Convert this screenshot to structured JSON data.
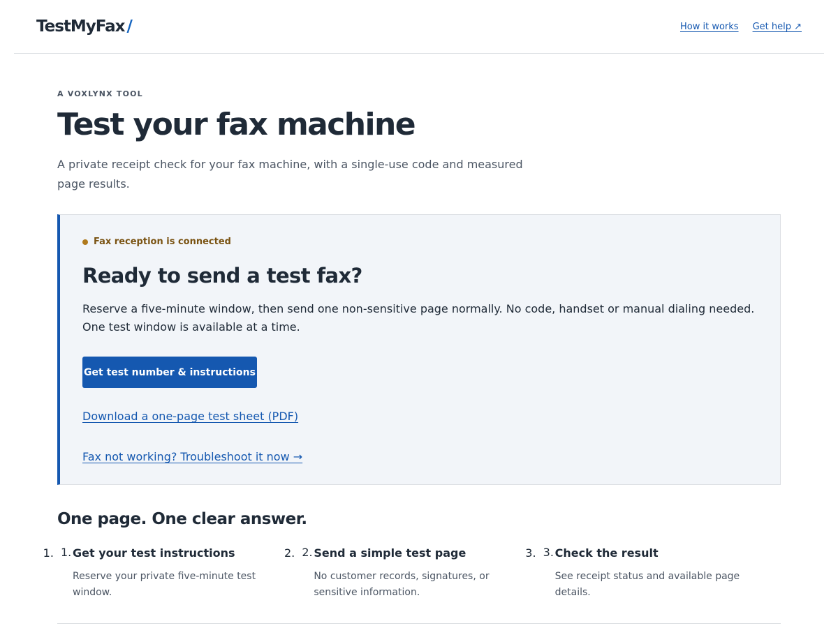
{
  "header": {
    "brand": "TestMyFax",
    "brand_slash": "/",
    "nav": [
      {
        "label": "How it works"
      },
      {
        "label": "Get help ↗"
      }
    ]
  },
  "hero": {
    "eyebrow": "A VOXLYNX TOOL",
    "title": "Test your fax machine",
    "intro": "A private receipt check for your fax machine, with a single-use code and measured page results."
  },
  "card": {
    "status": "Fax reception is connected",
    "title": "Ready to send a test fax?",
    "description": "Reserve a five-minute window, then send one non-sensitive page normally. No code, handset or manual dialing needed. One test window is available at a time.",
    "cta_label": "Get test number & instructions",
    "pdf_link": "Download a one-page test sheet (PDF)",
    "troubleshoot_link": "Fax not working? Troubleshoot it now →"
  },
  "steps_section": {
    "title": "One page. One clear answer.",
    "steps": [
      {
        "num": "1.",
        "title": "Get your test instructions",
        "desc": "Reserve your private five-minute test window."
      },
      {
        "num": "2.",
        "title": "Send a simple test page",
        "desc": "No customer records, signatures, or sensitive information."
      },
      {
        "num": "3.",
        "title": "Check the result",
        "desc": "See receipt status and available page details."
      }
    ]
  },
  "colors": {
    "accent": "#1558b0",
    "status_dot": "#b07a1d",
    "card_bg": "#f2f5f9"
  }
}
